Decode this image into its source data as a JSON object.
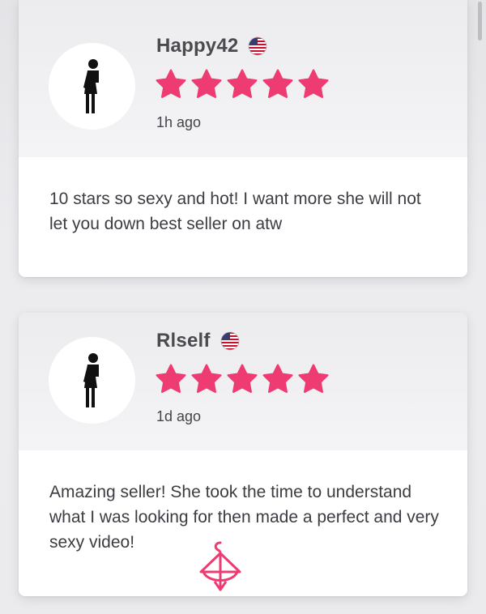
{
  "reviews": [
    {
      "username": "Happy42",
      "flag_icon": "us-flag-icon",
      "rating": 5,
      "max_rating": 5,
      "time": "1h ago",
      "text": "10 stars so sexy and hot! I want more she will not let you down best seller on atw"
    },
    {
      "username": "Rlself",
      "flag_icon": "us-flag-icon",
      "rating": 5,
      "max_rating": 5,
      "time": "1d ago",
      "text": "Amazing seller! She took the time to understand what I was looking for then made a perfect and very sexy video!"
    }
  ],
  "colors": {
    "star": "#ee3c72",
    "watermark": "#ee3c72"
  }
}
